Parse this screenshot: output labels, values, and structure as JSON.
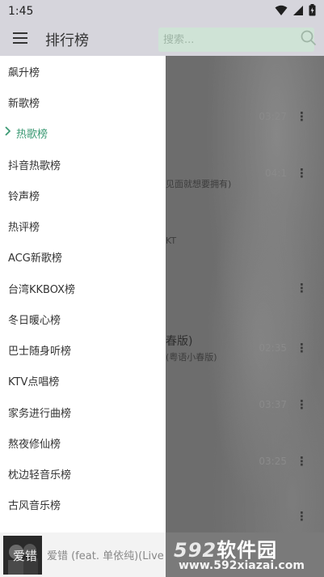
{
  "status_bar": {
    "time": "1:45",
    "icons": [
      "wifi-icon",
      "signal-icon",
      "battery-icon"
    ]
  },
  "app_bar": {
    "title": "排行榜",
    "search_placeholder": "搜索..."
  },
  "drawer": {
    "items": [
      {
        "label": "飙升榜",
        "active": false
      },
      {
        "label": "新歌榜",
        "active": false
      },
      {
        "label": "热歌榜",
        "active": true
      },
      {
        "label": "抖音热歌榜",
        "active": false
      },
      {
        "label": "铃声榜",
        "active": false
      },
      {
        "label": "热评榜",
        "active": false
      },
      {
        "label": "ACG新歌榜",
        "active": false
      },
      {
        "label": "台湾KKBOX榜",
        "active": false
      },
      {
        "label": "冬日暖心榜",
        "active": false
      },
      {
        "label": "巴士随身听榜",
        "active": false
      },
      {
        "label": "KTV点唱榜",
        "active": false
      },
      {
        "label": "家务进行曲榜",
        "active": false
      },
      {
        "label": "熬夜修仙榜",
        "active": false
      },
      {
        "label": "枕边轻音乐榜",
        "active": false
      },
      {
        "label": "古风音乐榜",
        "active": false
      }
    ]
  },
  "background_list": {
    "times": [
      "03:27",
      "04:1",
      "",
      "",
      "02:35",
      "03:37",
      "03:25"
    ],
    "texts": [
      "见面就想要拥有)",
      "KT",
      "春版)",
      "(粤语小春版)"
    ]
  },
  "mini_player": {
    "cover_text": "爱错",
    "title": "爱错 (feat. 单依纯)(Live"
  },
  "watermark": {
    "logo_num": "592",
    "logo_text": "软件园",
    "url": "www.592xiazai.com"
  },
  "colors": {
    "accent": "#3c9a74",
    "status_bg": "#d6d5dc",
    "search_bg": "#cfe3d6"
  }
}
